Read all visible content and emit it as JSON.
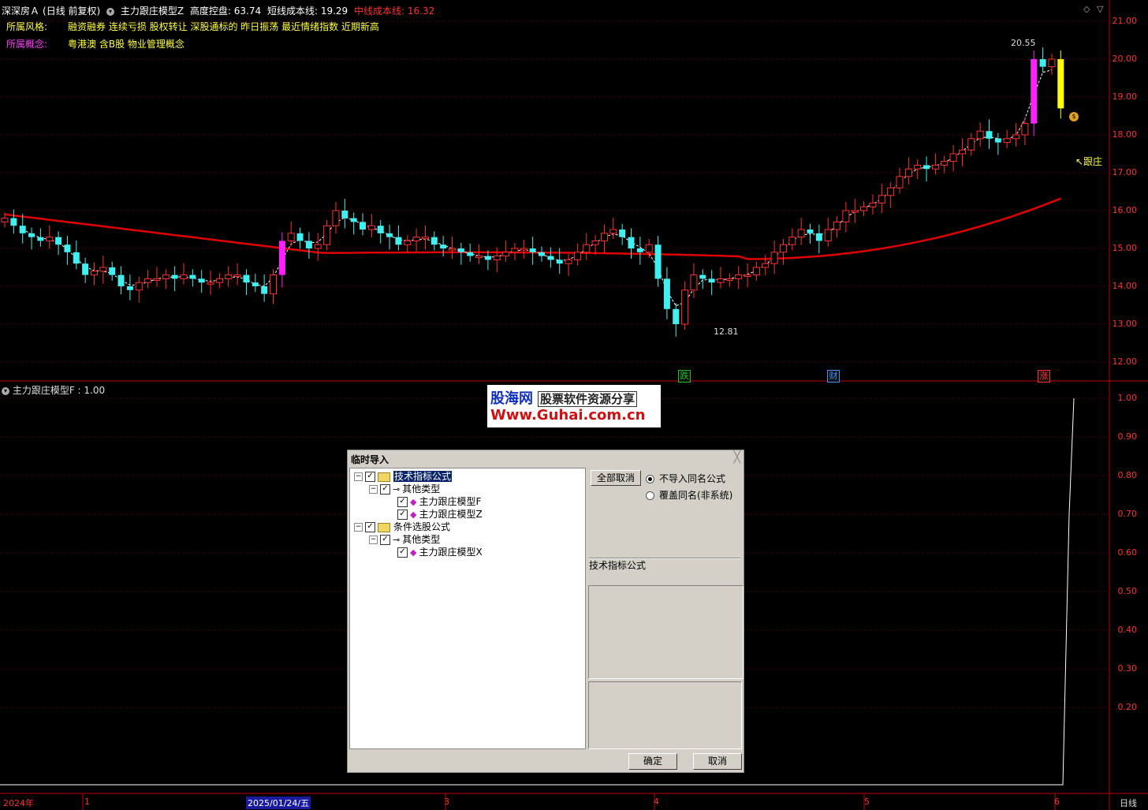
{
  "header": {
    "stock_name": "深深房Ａ",
    "period_mode": "(日线 前复权)",
    "indicator_name": "主力跟庄模型Z",
    "control_label": "高度控盘: 63.74",
    "short_cost_label": "短线成本线: 19.29",
    "mid_cost_label": "中线成本线: 16.32"
  },
  "info": {
    "style_label": "所属风格:",
    "style_value": "融资融券 连续亏损 股权转让 深股通标的 昨日振荡 最近情绪指数 近期新高",
    "concept_label": "所属概念:",
    "concept_value": "粤港澳 含B股 物业管理概念"
  },
  "main_chart": {
    "high_label": "20.55",
    "low_label": "12.81",
    "follow_label": "↖跟庄",
    "y_ticks": [
      "21.00",
      "20.00",
      "19.00",
      "18.00",
      "17.00",
      "16.00",
      "15.00",
      "14.00",
      "13.00",
      "12.00"
    ],
    "events": [
      {
        "text": "跌",
        "color": "#20c020"
      },
      {
        "text": "财",
        "color": "#4090ff"
      },
      {
        "text": "涨",
        "color": "#ff3030"
      }
    ],
    "colors": {
      "up": "#ff3030",
      "down": "#40f0f0",
      "ma": "#e00000",
      "signal": "#ff20ff",
      "yellow": "#ffff00"
    }
  },
  "sub_chart": {
    "title": "主力跟庄模型F : 1.00",
    "y_ticks": [
      "1.00",
      "0.90",
      "0.80",
      "0.70",
      "0.60",
      "0.50",
      "0.40",
      "0.30",
      "0.20"
    ]
  },
  "x_axis": {
    "labels": [
      "2024年",
      "1",
      "2025/01/24/五",
      "3",
      "4",
      "5",
      "6"
    ],
    "period": "日线"
  },
  "watermark": {
    "line1_brand": "股海网",
    "line1_tag": "股票软件资源分享",
    "line2": "Www.Guhai.com.cn"
  },
  "dialog": {
    "title": "临时导入",
    "close": "╳",
    "tree": {
      "root1": "技术指标公式",
      "root1_child": "其他类型",
      "formula_f": "主力跟庄模型F",
      "formula_z": "主力跟庄模型Z",
      "root2": "条件选股公式",
      "root2_child": "其他类型",
      "formula_x": "主力跟庄模型X"
    },
    "cancel_all": "全部取消",
    "radio_skip": "不导入同名公式",
    "radio_overwrite": "覆盖同名(非系统)",
    "category_label": "技术指标公式",
    "ok": "确定",
    "cancel": "取消"
  }
}
